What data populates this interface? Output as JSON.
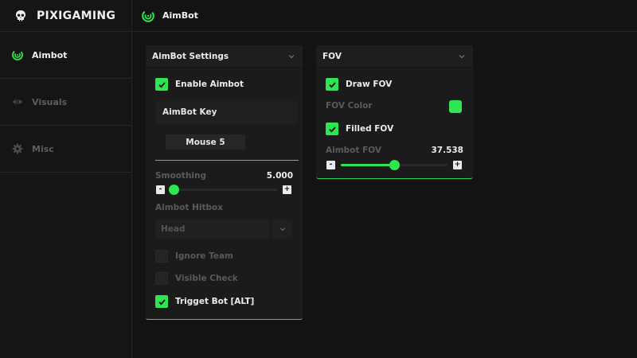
{
  "brand": {
    "name": "PIXIGAMING"
  },
  "colors": {
    "accent": "#2ee552",
    "background": "#131313",
    "panel": "#1b1b1b",
    "dim_text": "#5a5a5a"
  },
  "sidebar": {
    "items": [
      {
        "label": "Aimbot",
        "icon": "target-icon",
        "active": true
      },
      {
        "label": "Visuals",
        "icon": "eye-icon",
        "active": false
      },
      {
        "label": "Misc",
        "icon": "gear-icon",
        "active": false
      }
    ]
  },
  "topbar": {
    "title": "AimBot",
    "icon": "target-icon"
  },
  "aimbot_panel": {
    "title": "AimBot Settings",
    "enable_label": "Enable Aimbot",
    "enable_checked": true,
    "key_title": "AimBot Key",
    "key_value": "Mouse 5",
    "smoothing_label": "Smoothing",
    "smoothing_value": "5.000",
    "smoothing_fraction": 0.04,
    "hitbox_label": "Aimbot Hitbox",
    "hitbox_value": "Head",
    "ignore_team_label": "Ignore Team",
    "ignore_team_checked": false,
    "visible_check_label": "Visible Check",
    "visible_check_checked": false,
    "trigger_label": "Trigget Bot [ALT]",
    "trigger_checked": true,
    "minus": "-",
    "plus": "+"
  },
  "fov_panel": {
    "title": "FOV",
    "draw_label": "Draw FOV",
    "draw_checked": true,
    "color_label": "FOV Color",
    "filled_label": "Filled FOV",
    "filled_checked": true,
    "fov_label": "Aimbot FOV",
    "fov_value": "37.538",
    "fov_fraction": 0.5,
    "minus": "-",
    "plus": "+"
  }
}
